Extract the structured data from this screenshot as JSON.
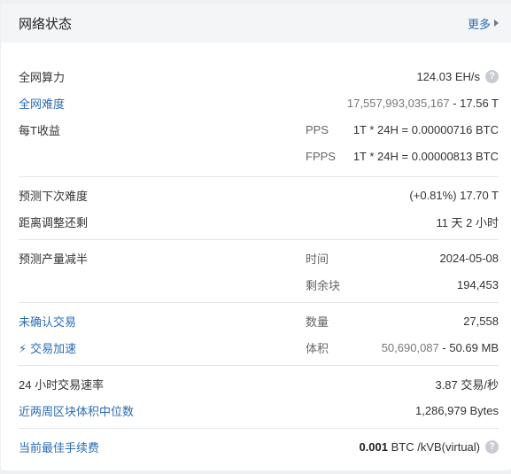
{
  "header": {
    "title": "网络状态",
    "more_label": "更多"
  },
  "hashrate": {
    "label": "全网算力",
    "value": "124.03 EH/s"
  },
  "difficulty": {
    "label": "全网难度",
    "value_grey": "17,557,993,035,167",
    "value_sep": " - ",
    "value": "17.56 T"
  },
  "earnings": {
    "label": "每T收益",
    "pps": {
      "name": "PPS",
      "formula": "1T * 24H = 0.00000716 BTC"
    },
    "fpps": {
      "name": "FPPS",
      "formula": "1T * 24H = 0.00000813 BTC"
    }
  },
  "next_difficulty": {
    "label": "预测下次难度",
    "value": "(+0.81%) 17.70 T"
  },
  "adjust_remaining": {
    "label": "距离调整还剩",
    "value": "11 天 2 小时"
  },
  "halving": {
    "label": "预测产量减半",
    "time_label": "时间",
    "time_value": "2024-05-08",
    "blocks_label": "剩余块",
    "blocks_value": "194,453"
  },
  "unconfirmed": {
    "label": "未确认交易",
    "count_label": "数量",
    "count_value": "27,558",
    "accelerate_label": "交易加速",
    "size_label": "体积",
    "size_grey": "50,690,087",
    "size_sep": " - ",
    "size_value": "50.69 MB"
  },
  "tx_rate": {
    "label": "24 小时交易速率",
    "value": "3.87 交易/秒"
  },
  "block_median": {
    "label": "近两周区块体积中位数",
    "value": "1,286,979 Bytes"
  },
  "best_fee": {
    "label": "当前最佳手续费",
    "value_bold": "0.001",
    "value_unit": " BTC /kVB(virtual)"
  },
  "colors": {
    "link": "#2a6cb3",
    "header_bg": "#f4f5f7",
    "page_bg": "#eef0f4"
  }
}
